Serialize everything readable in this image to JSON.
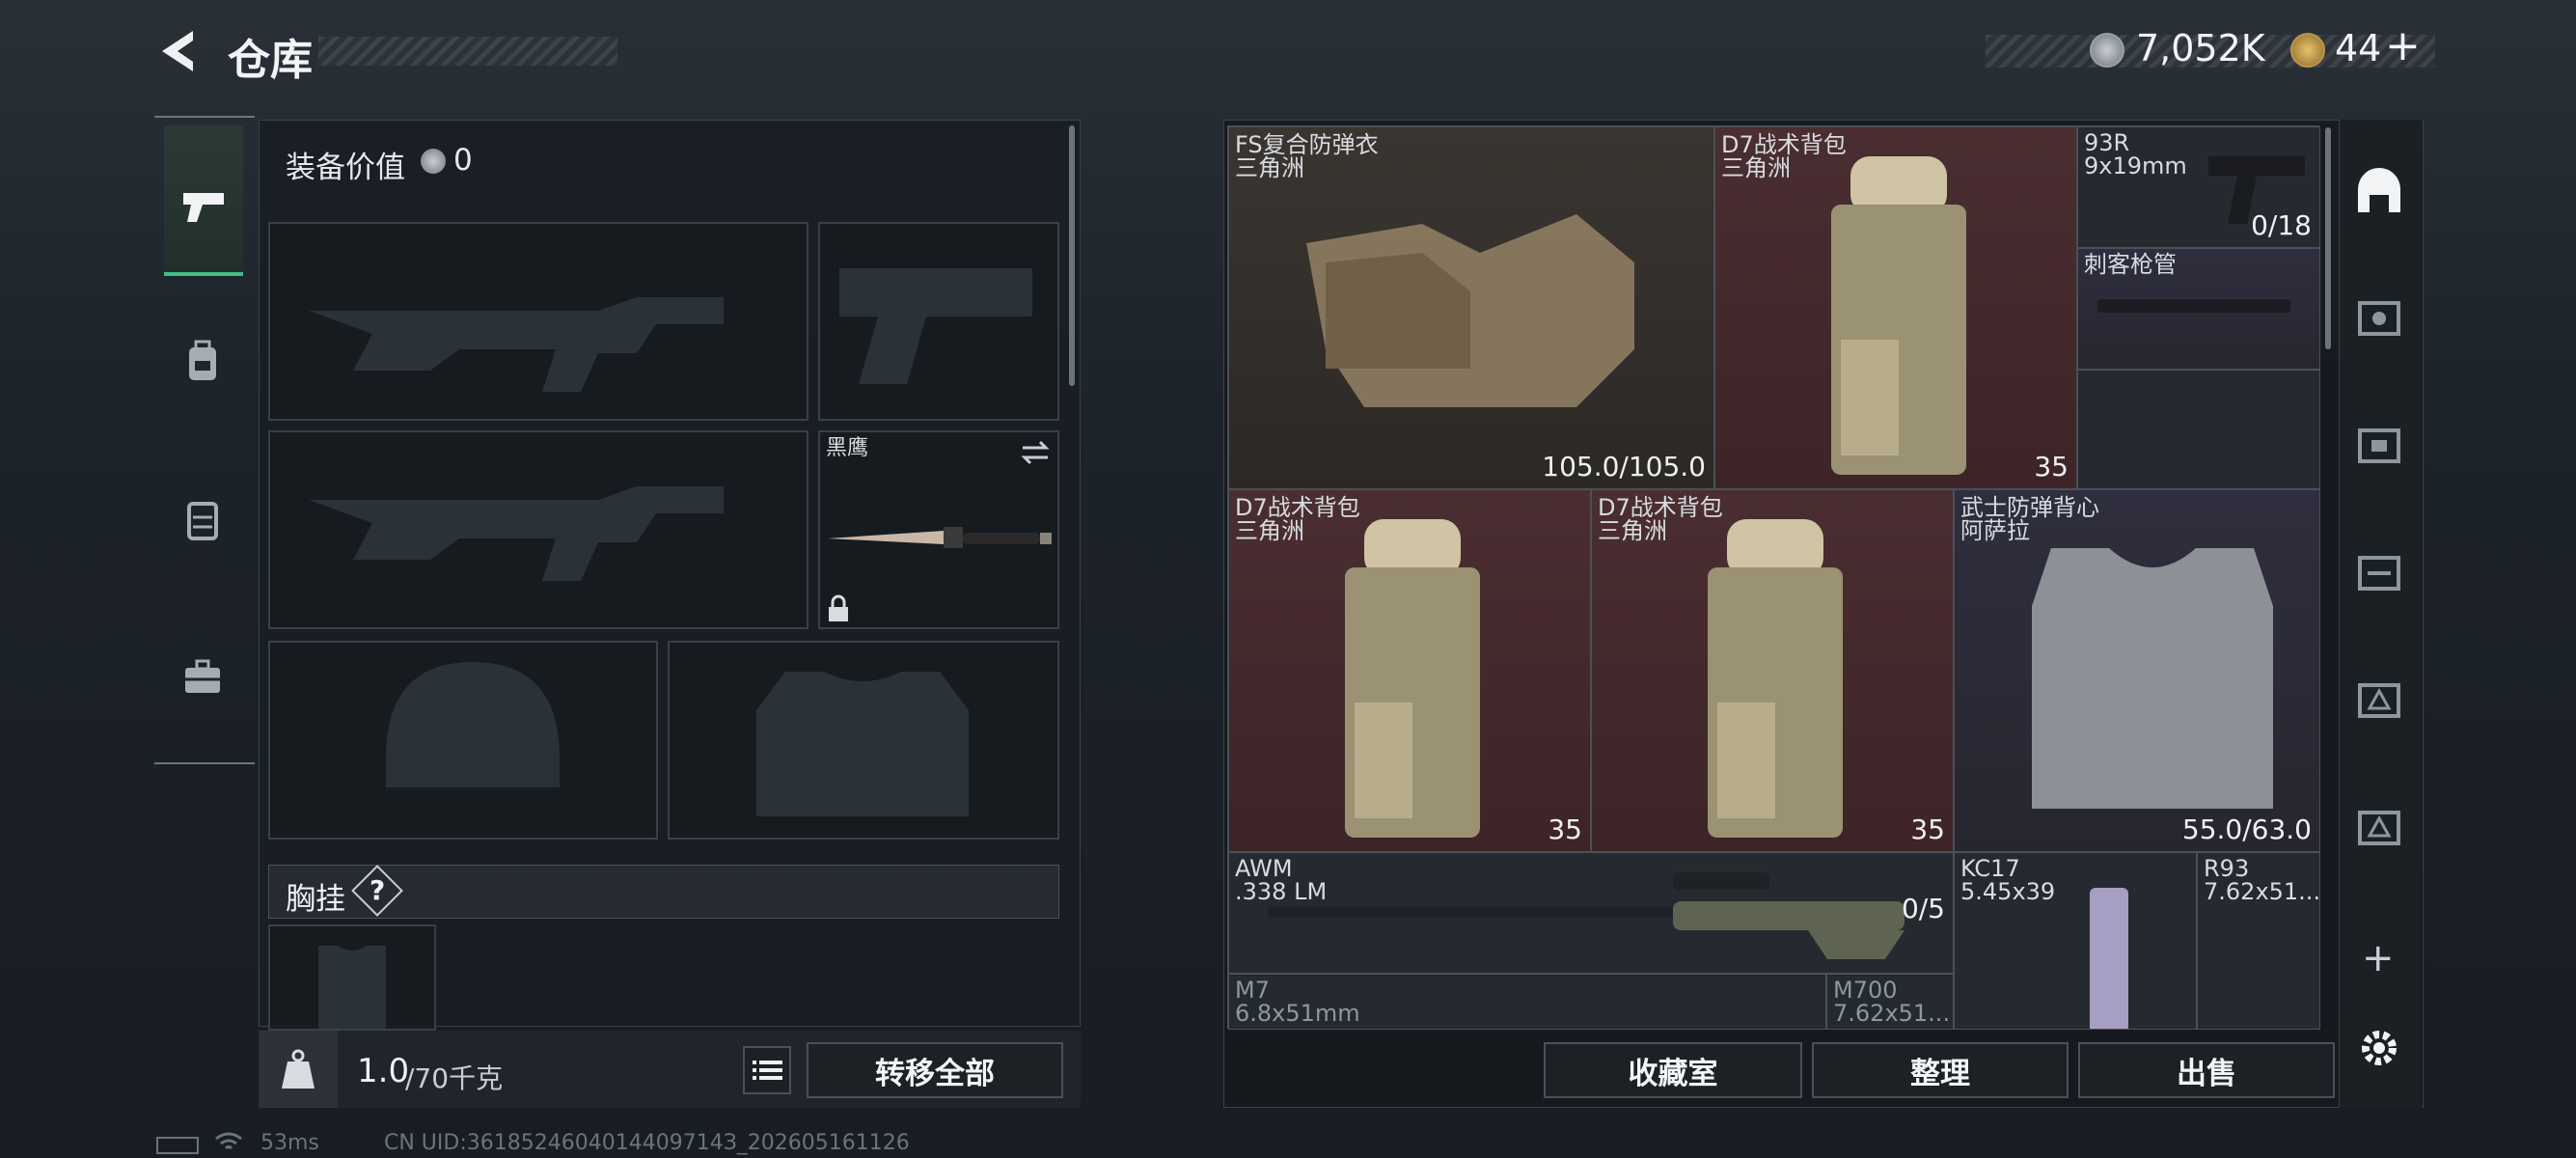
{
  "header": {
    "title": "仓库",
    "currency_amount": "7,052K",
    "tokens": "44",
    "plus": "+"
  },
  "left": {
    "equip_value_label": "装备价值",
    "equip_value": "0",
    "knife_label": "黑鹰",
    "chest_label": "胸挂",
    "help": "?",
    "weight_current": "1.0",
    "weight_max": "/70千克",
    "transfer_all": "转移全部",
    "kg": "KG"
  },
  "items": [
    {
      "name": "FS复合防弹衣",
      "sub": "三角洲",
      "value": "105.0/105.0"
    },
    {
      "name": "D7战术背包",
      "sub": "三角洲",
      "value": "35"
    },
    {
      "name": "93R",
      "sub": "9x19mm",
      "value": "0/18"
    },
    {
      "name": "刺客枪管",
      "sub": "",
      "value": ""
    },
    {
      "name": "D7战术背包",
      "sub": "三角洲",
      "value": "35"
    },
    {
      "name": "D7战术背包",
      "sub": "三角洲",
      "value": "35"
    },
    {
      "name": "武士防弹背心",
      "sub": "阿萨拉",
      "value": "55.0/63.0"
    },
    {
      "name": "AWM",
      "sub": ".338 LM",
      "value": "0/5"
    },
    {
      "name": "KC17",
      "sub": "5.45x39",
      "value": ""
    },
    {
      "name": "R93",
      "sub": "7.62x51...",
      "value": ""
    },
    {
      "name": "M7",
      "sub": "6.8x51mm",
      "value": ""
    },
    {
      "name": "M700",
      "sub": "7.62x51...",
      "value": ""
    }
  ],
  "bottom": {
    "collection": "收藏室",
    "organize": "整理",
    "sell": "出售"
  },
  "status": {
    "ping": "53ms",
    "uid": "CN UID:3618524604014409714З_202605161126"
  },
  "colors": {
    "accent_green": "#3fbf86",
    "red_cell": "#4a2e31",
    "purple_cell": "#2f2e3e"
  }
}
